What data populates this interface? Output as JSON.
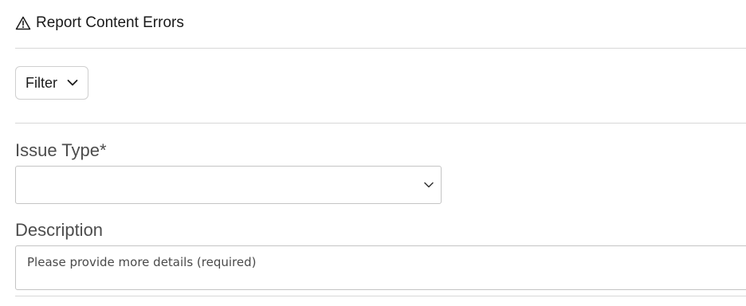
{
  "header": {
    "title": "Report Content Errors",
    "icon": "warning-triangle-icon"
  },
  "filter": {
    "label": "Filter",
    "icon": "chevron-down-icon"
  },
  "form": {
    "issue_type": {
      "label": "Issue Type*",
      "value": ""
    },
    "description": {
      "label": "Description",
      "placeholder": "Please provide more details (required)"
    }
  }
}
